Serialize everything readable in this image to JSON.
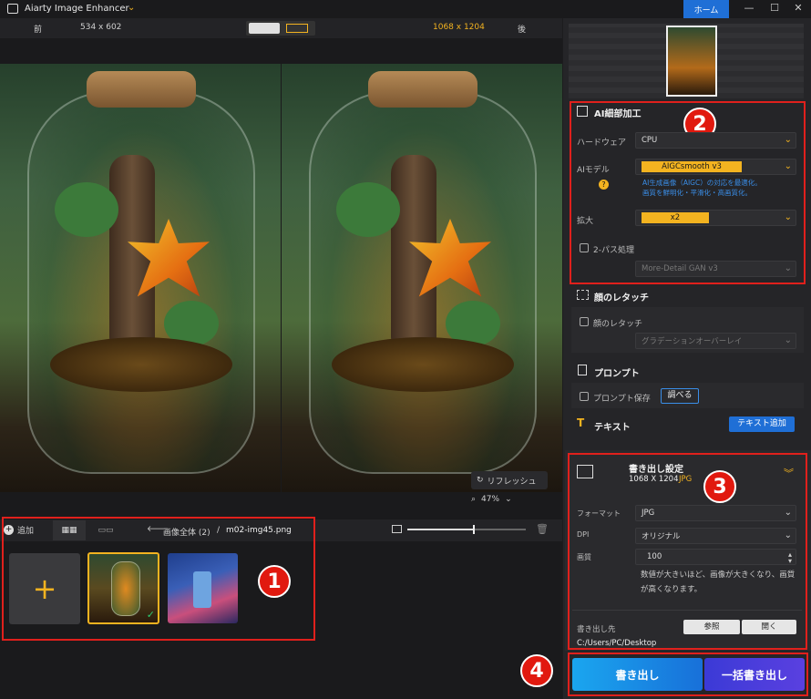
{
  "app": {
    "title": "Aiarty Image Enhancer",
    "home": "ホーム"
  },
  "viewer": {
    "before_label": "前",
    "before_size": "534 x 602",
    "after_size": "1068 x 1204",
    "after_label": "後",
    "refresh": "リフレッシュ",
    "zoom": "47%"
  },
  "files": {
    "add": "追加",
    "breadcrumb_root": "画像全体 (2)",
    "separator": "/",
    "current_file": "m02-img45.png",
    "slider_value": 0.55
  },
  "ai_panel": {
    "title": "AI細部加工",
    "hardware_label": "ハードウェア",
    "hardware_value": "CPU",
    "model_label": "AIモデル",
    "model_value": "AIGCsmooth  v3",
    "model_desc_1": "AI生成画像（AIGC）の対応を最適化。",
    "model_desc_2": "画質を鮮明化・平滑化・高画質化。",
    "scale_label": "拡大",
    "scale_value": "x2",
    "twopass_label": "2-パス処理",
    "twopass_model": "More-Detail GAN  v3"
  },
  "face": {
    "title": "顔のレタッチ",
    "checkbox_label": "顔のレタッチ",
    "mode": "グラデーションオーバーレイ"
  },
  "prompt": {
    "title": "プロンプト",
    "save_label": "プロンプト保存",
    "inspect": "調べる"
  },
  "text": {
    "title": "テキスト",
    "add_btn": "テキスト追加"
  },
  "export_settings": {
    "title": "書き出し設定",
    "size": "1068 X 1204",
    "format_tag": "JPG",
    "format_label": "フォーマット",
    "format_value": "JPG",
    "dpi_label": "DPI",
    "dpi_value": "オリジナル",
    "quality_label": "画質",
    "quality_value": "100",
    "quality_note_1": "数値が大きいほど、画像が大きくなり、画質",
    "quality_note_2": "が高くなります。",
    "dest_label": "書き出し先",
    "browse": "参照",
    "open": "開く",
    "dest_path": "C:/Users/PC/Desktop"
  },
  "actions": {
    "export": "書き出し",
    "batch": "一括書き出し"
  },
  "badges": [
    "1",
    "2",
    "3",
    "4"
  ],
  "colors": {
    "accent": "#f3b320",
    "highlight": "#e0201c",
    "home": "#1f6fd6",
    "link": "#3a8ee8"
  }
}
